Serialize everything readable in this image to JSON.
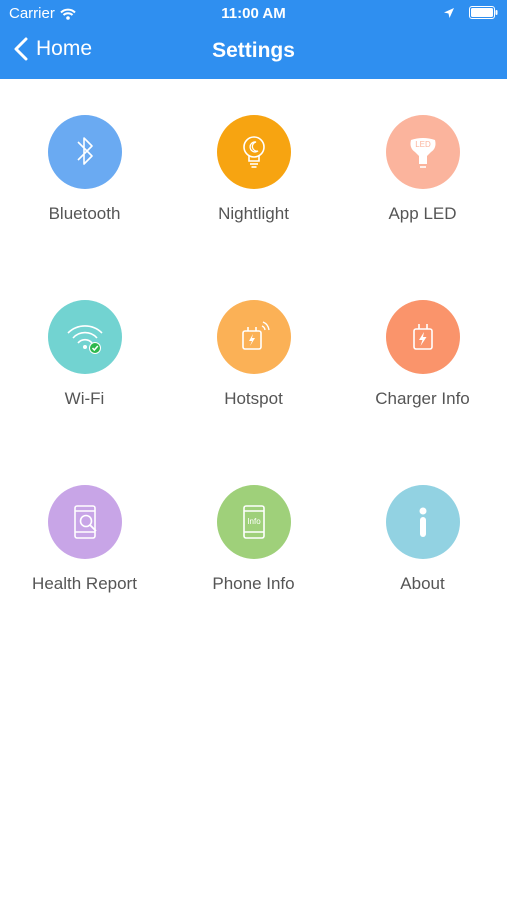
{
  "status_bar": {
    "carrier": "Carrier",
    "time": "11:00 AM"
  },
  "nav": {
    "back_label": "Home",
    "title": "Settings"
  },
  "colors": {
    "header": "#2f8ff0",
    "bluetooth": "#6aaaf2",
    "nightlight": "#f7a411",
    "app_led": "#fbb49d",
    "wifi": "#72d3d1",
    "hotspot": "#fbb156",
    "charger_info": "#fa946b",
    "health_report": "#c8a5e7",
    "phone_info": "#9fd07a",
    "about": "#92d2e2"
  },
  "items": [
    {
      "label": "Bluetooth",
      "icon": "bluetooth-icon"
    },
    {
      "label": "Nightlight",
      "icon": "lightbulb-moon-icon"
    },
    {
      "label": "App LED",
      "icon": "led-bulb-icon",
      "icon_text": "LED"
    },
    {
      "label": "Wi-Fi",
      "icon": "wifi-check-icon"
    },
    {
      "label": "Hotspot",
      "icon": "hotspot-icon"
    },
    {
      "label": "Charger Info",
      "icon": "charger-icon"
    },
    {
      "label": "Health Report",
      "icon": "phone-search-icon"
    },
    {
      "label": "Phone Info",
      "icon": "phone-info-icon",
      "icon_text": "Info"
    },
    {
      "label": "About",
      "icon": "info-icon"
    }
  ]
}
